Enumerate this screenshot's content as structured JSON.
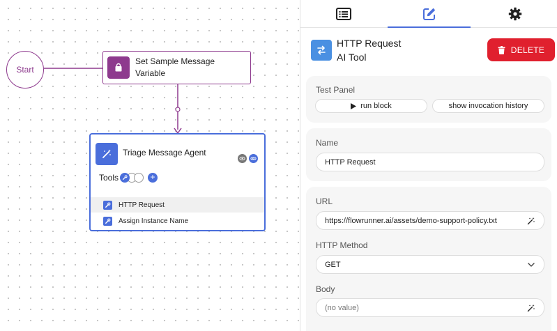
{
  "canvas": {
    "start_label": "Start",
    "set_node_label": "Set Sample Message Variable",
    "agent": {
      "title": "Triage Message Agent",
      "tools_label": "Tools",
      "tools_add_symbol": "+",
      "tools": [
        {
          "label": "HTTP Request",
          "active": true
        },
        {
          "label": "Assign Instance Name",
          "active": false
        }
      ]
    }
  },
  "panel": {
    "tabs": [
      {
        "name": "list-icon",
        "active": false
      },
      {
        "name": "edit-icon",
        "active": true
      },
      {
        "name": "gear-icon",
        "active": false
      }
    ],
    "header": {
      "title": "HTTP Request",
      "subtitle": "AI Tool",
      "delete_label": "DELETE"
    },
    "test_panel": {
      "label": "Test Panel",
      "run_label": "run block",
      "history_label": "show invocation history"
    },
    "name_section": {
      "label": "Name",
      "value": "HTTP Request"
    },
    "url_section": {
      "label": "URL",
      "value": "https://flowrunner.ai/assets/demo-support-policy.txt",
      "method_label": "HTTP Method",
      "method_value": "GET",
      "body_label": "Body",
      "body_value": "(no value)"
    }
  },
  "colors": {
    "accent": "#4a6edb",
    "purple": "#8e3a8e",
    "delete": "#e0202e",
    "header_icon": "#4a90e2"
  }
}
